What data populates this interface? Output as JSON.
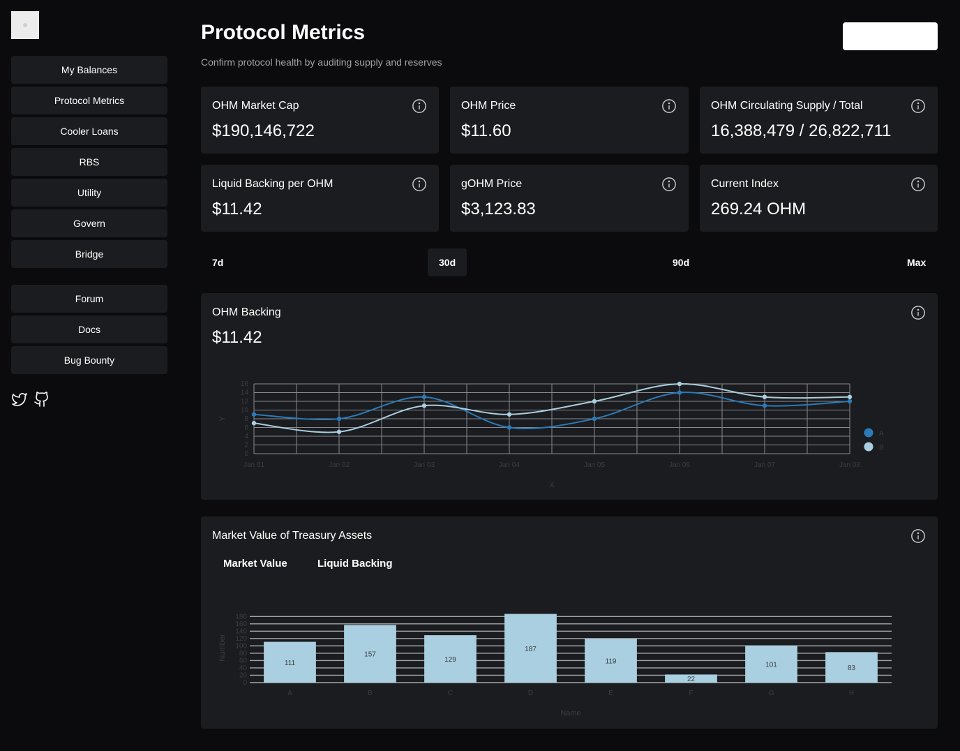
{
  "sidebar": {
    "items": [
      {
        "label": "My Balances"
      },
      {
        "label": "Protocol Metrics"
      },
      {
        "label": "Cooler Loans"
      },
      {
        "label": "RBS"
      },
      {
        "label": "Utility"
      },
      {
        "label": "Govern"
      },
      {
        "label": "Bridge"
      }
    ],
    "links": [
      {
        "label": "Forum"
      },
      {
        "label": "Docs"
      },
      {
        "label": "Bug Bounty"
      }
    ],
    "social_icons": [
      "twitter-icon",
      "github-icon"
    ]
  },
  "header": {
    "title": "Protocol Metrics",
    "subtitle": "Confirm protocol health by auditing supply and reserves",
    "connect_label": ""
  },
  "metrics": [
    {
      "label": "OHM Market Cap",
      "value": "$190,146,722"
    },
    {
      "label": "OHM Price",
      "value": "$11.60"
    },
    {
      "label": "OHM Circulating Supply / Total",
      "value": "16,388,479 / 26,822,711"
    },
    {
      "label": "Liquid Backing per OHM",
      "value": "$11.42"
    },
    {
      "label": "gOHM Price",
      "value": "$3,123.83"
    },
    {
      "label": "Current Index",
      "value": "269.24 OHM"
    }
  ],
  "ranges": {
    "options": [
      "7d",
      "30d",
      "90d",
      "Max"
    ],
    "selected": "30d"
  },
  "backing_chart": {
    "title": "OHM Backing",
    "value": "$11.42"
  },
  "treasury_chart": {
    "title": "Market Value of Treasury Assets",
    "tabs": [
      "Market Value",
      "Liquid Backing"
    ]
  },
  "colors": {
    "background": "#0b0b0d",
    "card": "#1b1c1f",
    "series_a": "#2b7bb9",
    "series_b": "#a9cfe0",
    "bar": "#a9cfe0"
  },
  "chart_data": [
    {
      "type": "line",
      "x": [
        "Jan 01",
        "Jan 02",
        "Jan 03",
        "Jan 04",
        "Jan 05",
        "Jan 06",
        "Jan 07",
        "Jan 08"
      ],
      "series": [
        {
          "name": "A",
          "values": [
            9,
            8,
            13,
            6,
            8,
            14,
            11,
            12
          ]
        },
        {
          "name": "B",
          "values": [
            7,
            5,
            11,
            9,
            12,
            16,
            13,
            13
          ]
        }
      ],
      "xlabel": "X",
      "ylabel": "Y",
      "ylim": [
        0,
        16
      ],
      "yticks": [
        0,
        2,
        4,
        6,
        8,
        10,
        12,
        14,
        16
      ],
      "grid": true,
      "legend": "right"
    },
    {
      "type": "bar",
      "categories": [
        "A",
        "B",
        "C",
        "D",
        "E",
        "F",
        "G",
        "H"
      ],
      "values": [
        111,
        157,
        129,
        187,
        119,
        22,
        101,
        83
      ],
      "xlabel": "Name",
      "ylabel": "Number",
      "ylim": [
        0,
        190
      ],
      "yticks": [
        0,
        20,
        40,
        60,
        80,
        100,
        120,
        140,
        160,
        180
      ],
      "grid": true
    }
  ]
}
